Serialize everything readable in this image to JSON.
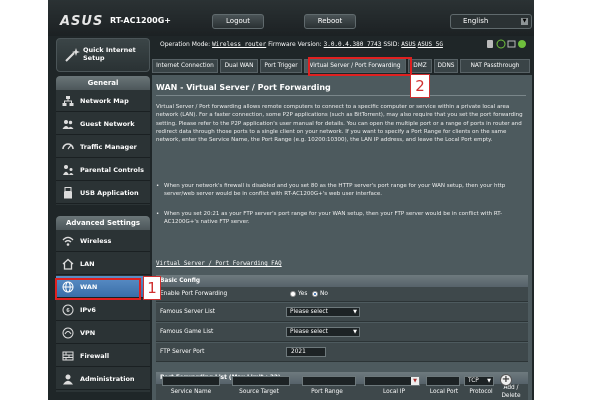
{
  "header": {
    "logo": "ASUS",
    "model": "RT-AC1200G+",
    "logout_label": "Logout",
    "reboot_label": "Reboot",
    "language": "English"
  },
  "sidebar": {
    "qis_line1": "Quick Internet",
    "qis_line2": "Setup",
    "general_title": "General",
    "general_items": [
      {
        "label": "Network Map",
        "icon": "network-map-icon"
      },
      {
        "label": "Guest Network",
        "icon": "guest-network-icon"
      },
      {
        "label": "Traffic Manager",
        "icon": "traffic-manager-icon"
      },
      {
        "label": "Parental Controls",
        "icon": "parental-controls-icon"
      },
      {
        "label": "USB Application",
        "icon": "usb-icon"
      }
    ],
    "advanced_title": "Advanced Settings",
    "advanced_items": [
      {
        "label": "Wireless",
        "icon": "wireless-icon"
      },
      {
        "label": "LAN",
        "icon": "lan-icon"
      },
      {
        "label": "WAN",
        "icon": "globe-icon"
      },
      {
        "label": "IPv6",
        "icon": "ipv6-icon"
      },
      {
        "label": "VPN",
        "icon": "vpn-icon"
      },
      {
        "label": "Firewall",
        "icon": "firewall-icon"
      },
      {
        "label": "Administration",
        "icon": "administration-icon"
      }
    ]
  },
  "status": {
    "opmode_label": "Operation Mode:",
    "opmode_value": "Wireless router",
    "fw_label": "Firmware Version:",
    "fw_value": "3.0.0.4.380_7743",
    "ssid_label": "SSID:",
    "ssid1": "ASUS",
    "ssid2": "ASUS_5G"
  },
  "tabs": [
    "Internet Connection",
    "Dual WAN",
    "Port Trigger",
    "Virtual Server / Port Forwarding",
    "DMZ",
    "DDNS",
    "NAT Passthrough"
  ],
  "annotations": {
    "wan_badge": "1",
    "tab_badge": "2"
  },
  "main": {
    "title": "WAN - Virtual Server / Port Forwarding",
    "description": "Virtual Server / Port forwarding allows remote computers to connect to a specific computer or service within a private local area network (LAN). For a faster connection, some P2P applications (such as BitTorrent), may also require that you set the port forwarding setting. Please refer to the P2P application's user manual for details. You can open the multiple port or a range of ports in router and redirect data through those ports to a single client on your network.",
    "description2": "If you want to specify a Port Range for clients on the same network, enter the Service Name, the Port Range (e.g. 10200:10300), the LAN IP address, and leave the Local Port empty.",
    "bullet1": "When your network's firewall is disabled and you set 80 as the HTTP server's port range for your WAN setup, then your http server/web server would be in conflict with RT-AC1200G+'s web user interface.",
    "bullet2": "When you set 20:21 as your FTP server's port range for your WAN setup, then your FTP server would be in conflict with RT-AC1200G+'s native FTP server.",
    "faq_link": "Virtual Server / Port Forwarding FAQ"
  },
  "basic_config": {
    "title": "Basic Config",
    "enable_label": "Enable Port Forwarding",
    "yes_label": "Yes",
    "no_label": "No",
    "enabled": "No",
    "famous_server_label": "Famous Server List",
    "famous_server_value": "Please select",
    "famous_game_label": "Famous Game List",
    "famous_game_value": "Please select",
    "ftp_label": "FTP Server Port",
    "ftp_value": "2021"
  },
  "pf_list": {
    "title": "Port Forwarding List (Max Limit : 32)",
    "columns": [
      "Service Name",
      "Source Target",
      "Port Range",
      "Local IP",
      "Local Port",
      "Protocol",
      "Add / Delete"
    ],
    "protocol_value": "TCP"
  },
  "colors": {
    "accent": "#4a7fbf",
    "annotation_red": "#e02020"
  }
}
